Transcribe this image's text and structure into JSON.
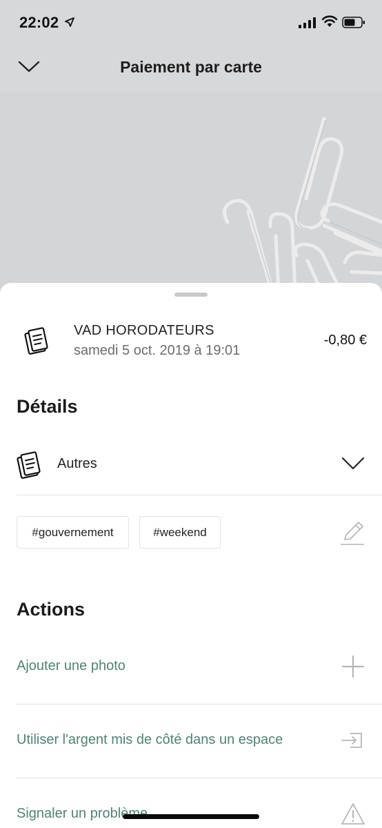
{
  "status_bar": {
    "time": "22:02"
  },
  "header": {
    "title": "Paiement par carte"
  },
  "transaction": {
    "merchant": "VAD HORODATEURS",
    "date": "samedi 5 oct. 2019 à 19:01",
    "amount": "-0,80 €"
  },
  "details": {
    "title": "Détails",
    "category": "Autres",
    "tags": [
      "#gouvernement",
      "#weekend"
    ]
  },
  "actions": {
    "title": "Actions",
    "items": [
      {
        "label": "Ajouter une photo",
        "icon": "plus-icon"
      },
      {
        "label": "Utiliser l'argent mis de côté dans un espace",
        "icon": "transfer-in-icon"
      },
      {
        "label": "Signaler un problème",
        "icon": "warning-icon"
      }
    ]
  },
  "colors": {
    "accent": "#4e8374",
    "background": "#d7d8da",
    "sheet": "#ffffff"
  }
}
